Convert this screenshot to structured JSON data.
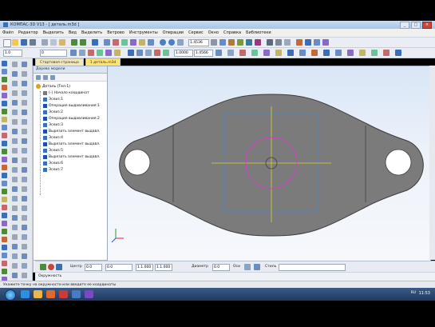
{
  "window": {
    "title": "КОМПАС-3D V13 - [ деталь.m3d ]",
    "buttons": {
      "minimize": "_",
      "maximize": "□",
      "close": "×"
    }
  },
  "menu": [
    "Файл",
    "Редактор",
    "Выделить",
    "Вид",
    "Выделить",
    "Ветрово",
    "Инструменты",
    "Операции",
    "Сервис",
    "Окно",
    "Справка",
    "Библиотеки"
  ],
  "toolbar1": {
    "scale": "1.4536",
    "icons": [
      "new-icon",
      "open-icon",
      "save-icon",
      "print-icon",
      "cut-icon",
      "copy-icon",
      "paste-icon",
      "undo-icon",
      "redo-icon",
      "help-icon"
    ]
  },
  "toolbar2": {
    "step": "1.0",
    "layer": "0",
    "zoom": "1.0000",
    "zoom2": "1.4566"
  },
  "tabs": [
    {
      "label": "Стартовая страница",
      "active": false
    },
    {
      "label": "1 деталь.m3d",
      "active": true
    }
  ],
  "tree": {
    "header": "Дерево модели",
    "root": "Деталь (Тел-1)",
    "items": [
      {
        "label": "(-) Начало координат",
        "icon": "origin-icon",
        "color": "#7a7a7a"
      },
      {
        "label": "Эскиз:1",
        "icon": "sketch-icon",
        "color": "#3c6fb3"
      },
      {
        "label": "Операция выдавливания:1",
        "icon": "extrude-icon",
        "color": "#1e4fa0"
      },
      {
        "label": "Эскиз:2",
        "icon": "sketch-icon",
        "color": "#3c6fb3"
      },
      {
        "label": "Операция выдавливания:2",
        "icon": "extrude-icon",
        "color": "#1e4fa0"
      },
      {
        "label": "Эскиз:3",
        "icon": "sketch-icon",
        "color": "#3c6fb3"
      },
      {
        "label": "Вырезать элемент выдавл.",
        "icon": "cut-extrude-icon",
        "color": "#1e4fa0"
      },
      {
        "label": "Эскиз:4",
        "icon": "sketch-icon",
        "color": "#3c6fb3"
      },
      {
        "label": "Вырезать элемент выдавл.",
        "icon": "cut-extrude-icon",
        "color": "#1e4fa0"
      },
      {
        "label": "Эскиз:5",
        "icon": "sketch-icon",
        "color": "#3c6fb3"
      },
      {
        "label": "Вырезать элемент выдавл.",
        "icon": "cut-extrude-icon",
        "color": "#1e4fa0"
      },
      {
        "label": "Эскиз:6",
        "icon": "sketch-icon",
        "color": "#3c6fb3"
      },
      {
        "label": "Эскиз:7",
        "icon": "sketch-icon",
        "color": "#3c6fb3"
      }
    ],
    "bottom_tab": "Построение"
  },
  "properties": {
    "center_label": "Центр",
    "center_x": "0.0",
    "center_y": "0.0",
    "p1": "1.1.000",
    "p2": "1.1.000",
    "diameter_label": "Диаметр",
    "diameter": "0.0",
    "axes_label": "Оси",
    "style_label": "Стиль",
    "panel_tab": "Окружность"
  },
  "status": "Укажите точку на окружности или введите ее координаты",
  "taskbar": {
    "lang": "RU",
    "time": "11:53"
  },
  "colors": {
    "part_fill": "#7b7b7b",
    "part_edge": "#3d3d3d",
    "axis_x": "#e0d03a",
    "axis_y": "#e0d03a",
    "circle": "#d43cc4",
    "rect": "#4b86c8"
  }
}
